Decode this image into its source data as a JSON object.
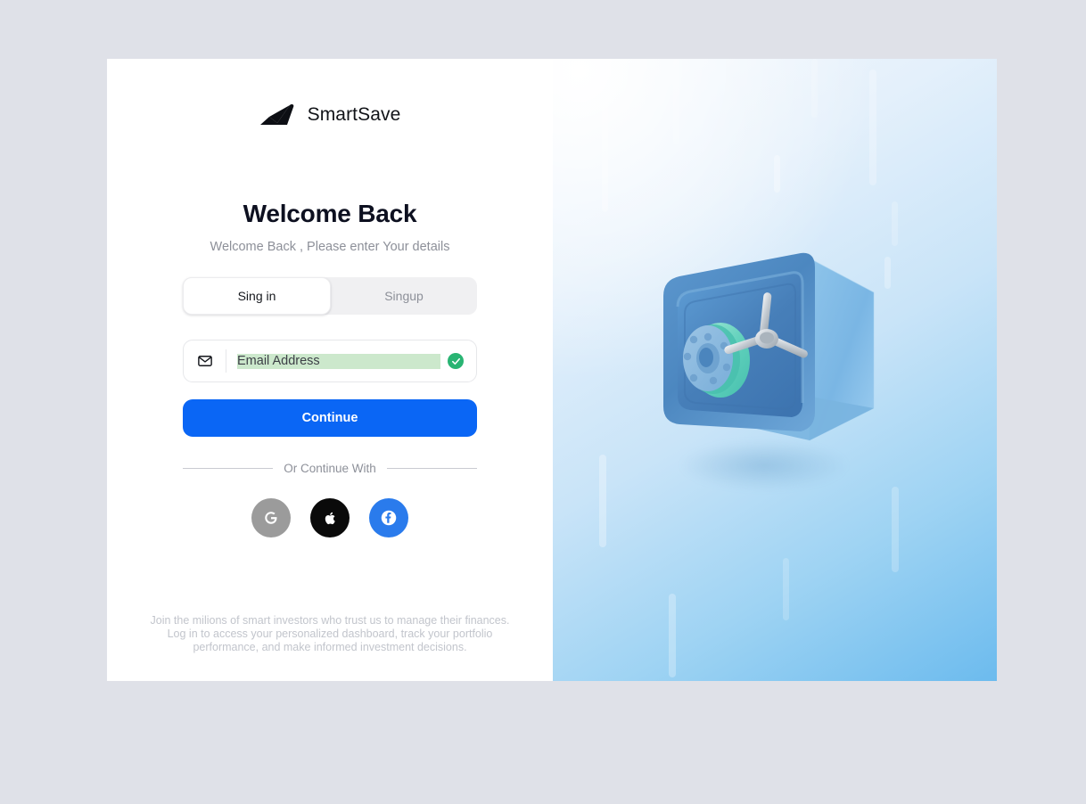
{
  "brand": {
    "name": "SmartSave",
    "logo_icon": "arrow-swoosh-logo-icon"
  },
  "heading": {
    "title": "Welcome Back",
    "subtitle": "Welcome Back , Please enter Your details"
  },
  "tabs": [
    {
      "id": "signin",
      "label": "Sing in",
      "active": true
    },
    {
      "id": "signup",
      "label": "Singup",
      "active": false
    }
  ],
  "email_field": {
    "icon": "envelope-icon",
    "value": "Email Address",
    "placeholder": "Email Address",
    "valid_icon": "check-circle-icon",
    "valid_color": "#29b473",
    "selection_color": "#cce8cc"
  },
  "primary_button": {
    "label": "Continue",
    "color": "#0a66f5"
  },
  "divider": {
    "label": "Or Continue With"
  },
  "social_buttons": [
    {
      "id": "google",
      "icon": "google-icon",
      "label": "Google",
      "color": "#9b9b9b"
    },
    {
      "id": "apple",
      "icon": "apple-icon",
      "label": "Apple",
      "color": "#0a0a0a"
    },
    {
      "id": "facebook",
      "icon": "facebook-icon",
      "label": "Facebook",
      "color": "#2a7bec"
    }
  ],
  "legal": {
    "text": "Join the milions of smart investors who trust us to manage their finances. Log in to access your personalized dashboard, track your portfolio performance, and make informed investment decisions."
  },
  "artwork": {
    "illustration": "3d-blue-safe-vault-illustration",
    "background_colors": [
      "#f4f8fd",
      "#c9e4f8",
      "#6cbbee"
    ]
  },
  "page": {
    "background_color": "#dfe1e8",
    "card_background": "#ffffff"
  }
}
